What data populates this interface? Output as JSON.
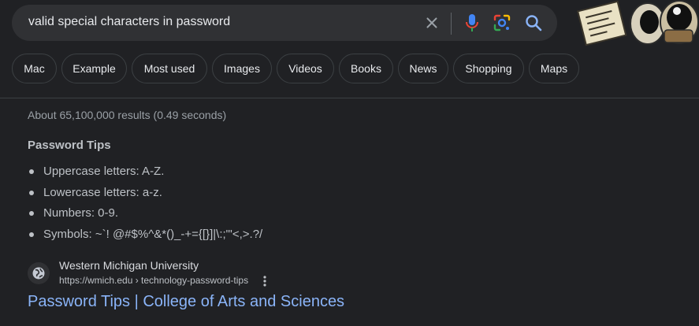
{
  "search": {
    "query": "valid special characters in password",
    "icons": [
      "close-icon",
      "mic-icon",
      "google-lens-icon",
      "search-icon"
    ]
  },
  "doodle": {
    "icon": "doodle-image"
  },
  "chips": [
    "Mac",
    "Example",
    "Most used",
    "Images",
    "Videos",
    "Books",
    "News",
    "Shopping",
    "Maps"
  ],
  "results_stats": "About 65,100,000 results (0.49 seconds)",
  "snippet": {
    "title": "Password Tips",
    "items": [
      "Uppercase letters: A-Z.",
      "Lowercase letters: a-z.",
      "Numbers: 0-9.",
      "Symbols: ~`! @#$%^&*()_-+={[}]|\\:;\"'<,>.?/"
    ]
  },
  "result": {
    "site_name": "Western Michigan University",
    "url": "https://wmich.edu › technology-password-tips",
    "title": "Password Tips | College of Arts and Sciences",
    "favicon": "globe-icon"
  },
  "colors": {
    "background": "#202124",
    "searchbar": "#303134",
    "link": "#8ab4f8",
    "text": "#bdc1c6"
  }
}
